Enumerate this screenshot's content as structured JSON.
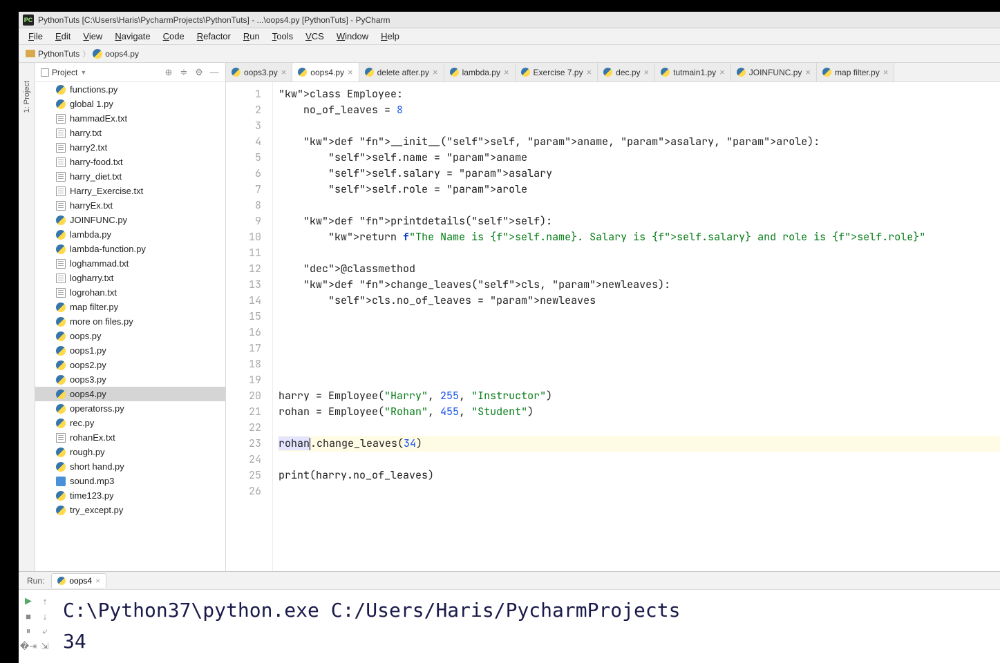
{
  "title": "PythonTuts [C:\\Users\\Haris\\PycharmProjects\\PythonTuts] - ...\\oops4.py [PythonTuts] - PyCharm",
  "menus": [
    "File",
    "Edit",
    "View",
    "Navigate",
    "Code",
    "Refactor",
    "Run",
    "Tools",
    "VCS",
    "Window",
    "Help"
  ],
  "breadcrumbs": {
    "project": "PythonTuts",
    "file": "oops4.py"
  },
  "sidebar": {
    "title": "Project",
    "files": [
      {
        "name": "functions.py",
        "type": "py"
      },
      {
        "name": "global 1.py",
        "type": "py"
      },
      {
        "name": "hammadEx.txt",
        "type": "txt"
      },
      {
        "name": "harry.txt",
        "type": "txt"
      },
      {
        "name": "harry2.txt",
        "type": "txt"
      },
      {
        "name": "harry-food.txt",
        "type": "txt"
      },
      {
        "name": "harry_diet.txt",
        "type": "txt"
      },
      {
        "name": "Harry_Exercise.txt",
        "type": "txt"
      },
      {
        "name": "harryEx.txt",
        "type": "txt"
      },
      {
        "name": "JOINFUNC.py",
        "type": "py"
      },
      {
        "name": "lambda.py",
        "type": "py"
      },
      {
        "name": "lambda-function.py",
        "type": "py"
      },
      {
        "name": "loghammad.txt",
        "type": "txt"
      },
      {
        "name": "logharry.txt",
        "type": "txt"
      },
      {
        "name": "logrohan.txt",
        "type": "txt"
      },
      {
        "name": "map filter.py",
        "type": "py"
      },
      {
        "name": "more on files.py",
        "type": "py"
      },
      {
        "name": "oops.py",
        "type": "py"
      },
      {
        "name": "oops1.py",
        "type": "py"
      },
      {
        "name": "oops2.py",
        "type": "py"
      },
      {
        "name": "oops3.py",
        "type": "py"
      },
      {
        "name": "oops4.py",
        "type": "py",
        "selected": true
      },
      {
        "name": "operatorss.py",
        "type": "py"
      },
      {
        "name": "rec.py",
        "type": "py"
      },
      {
        "name": "rohanEx.txt",
        "type": "txt"
      },
      {
        "name": "rough.py",
        "type": "py"
      },
      {
        "name": "short hand.py",
        "type": "py"
      },
      {
        "name": "sound.mp3",
        "type": "mp3"
      },
      {
        "name": "time123.py",
        "type": "py"
      },
      {
        "name": "try_except.py",
        "type": "py"
      }
    ]
  },
  "tabs": [
    {
      "label": "oops3.py"
    },
    {
      "label": "oops4.py",
      "active": true
    },
    {
      "label": "delete after.py"
    },
    {
      "label": "lambda.py"
    },
    {
      "label": "Exercise 7.py"
    },
    {
      "label": "dec.py"
    },
    {
      "label": "tutmain1.py"
    },
    {
      "label": "JOINFUNC.py"
    },
    {
      "label": "map filter.py"
    }
  ],
  "code": {
    "lines": 26,
    "highlighted": 23,
    "content": {
      "1": "class Employee:",
      "2": "    no_of_leaves = 8",
      "4": "    def __init__(self, aname, asalary, arole):",
      "5": "        self.name = aname",
      "6": "        self.salary = asalary",
      "7": "        self.role = arole",
      "9": "    def printdetails(self):",
      "10": "        return f\"The Name is {self.name}. Salary is {self.salary} and role is {self.role}\"",
      "12": "    @classmethod",
      "13": "    def change_leaves(cls, newleaves):",
      "14": "        cls.no_of_leaves = newleaves",
      "20": "harry = Employee(\"Harry\", 255, \"Instructor\")",
      "21": "rohan = Employee(\"Rohan\", 455, \"Student\")",
      "23": "rohan.change_leaves(34)",
      "25": "print(harry.no_of_leaves)"
    }
  },
  "run": {
    "label": "Run:",
    "tab": "oops4",
    "output_cmd": "C:\\Python37\\python.exe C:/Users/Haris/PycharmProjects",
    "output_result": "34"
  },
  "left_gutter": {
    "project_tab": "1: Project"
  }
}
